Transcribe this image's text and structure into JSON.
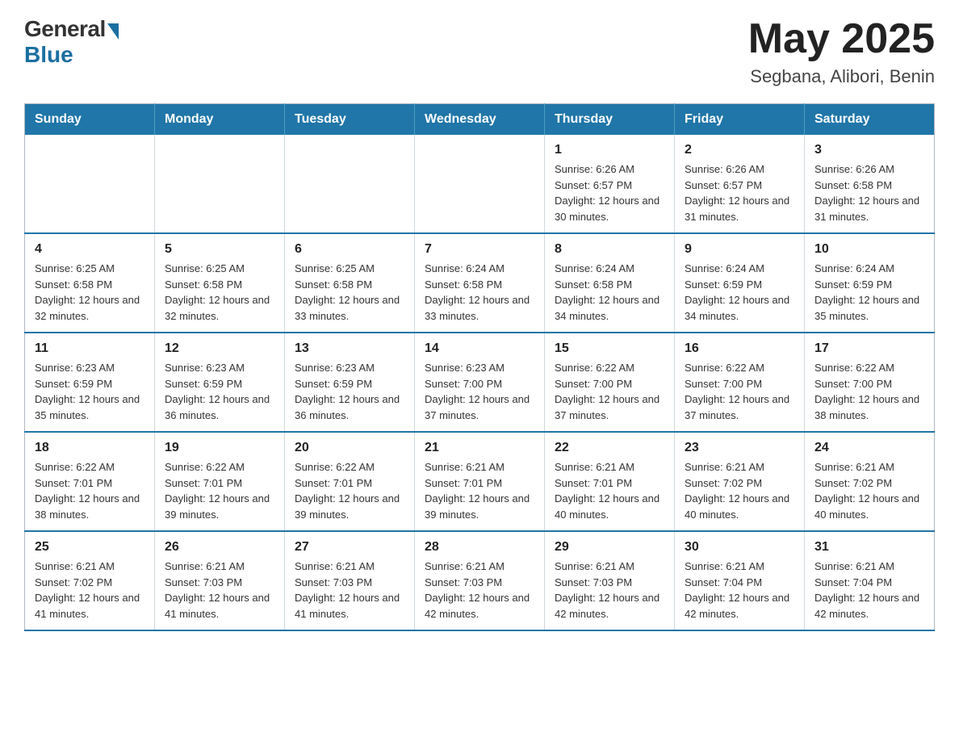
{
  "logo": {
    "general": "General",
    "blue": "Blue"
  },
  "title": {
    "month_year": "May 2025",
    "location": "Segbana, Alibori, Benin"
  },
  "weekdays": [
    "Sunday",
    "Monday",
    "Tuesday",
    "Wednesday",
    "Thursday",
    "Friday",
    "Saturday"
  ],
  "weeks": [
    [
      {
        "day": "",
        "info": ""
      },
      {
        "day": "",
        "info": ""
      },
      {
        "day": "",
        "info": ""
      },
      {
        "day": "",
        "info": ""
      },
      {
        "day": "1",
        "info": "Sunrise: 6:26 AM\nSunset: 6:57 PM\nDaylight: 12 hours and 30 minutes."
      },
      {
        "day": "2",
        "info": "Sunrise: 6:26 AM\nSunset: 6:57 PM\nDaylight: 12 hours and 31 minutes."
      },
      {
        "day": "3",
        "info": "Sunrise: 6:26 AM\nSunset: 6:58 PM\nDaylight: 12 hours and 31 minutes."
      }
    ],
    [
      {
        "day": "4",
        "info": "Sunrise: 6:25 AM\nSunset: 6:58 PM\nDaylight: 12 hours and 32 minutes."
      },
      {
        "day": "5",
        "info": "Sunrise: 6:25 AM\nSunset: 6:58 PM\nDaylight: 12 hours and 32 minutes."
      },
      {
        "day": "6",
        "info": "Sunrise: 6:25 AM\nSunset: 6:58 PM\nDaylight: 12 hours and 33 minutes."
      },
      {
        "day": "7",
        "info": "Sunrise: 6:24 AM\nSunset: 6:58 PM\nDaylight: 12 hours and 33 minutes."
      },
      {
        "day": "8",
        "info": "Sunrise: 6:24 AM\nSunset: 6:58 PM\nDaylight: 12 hours and 34 minutes."
      },
      {
        "day": "9",
        "info": "Sunrise: 6:24 AM\nSunset: 6:59 PM\nDaylight: 12 hours and 34 minutes."
      },
      {
        "day": "10",
        "info": "Sunrise: 6:24 AM\nSunset: 6:59 PM\nDaylight: 12 hours and 35 minutes."
      }
    ],
    [
      {
        "day": "11",
        "info": "Sunrise: 6:23 AM\nSunset: 6:59 PM\nDaylight: 12 hours and 35 minutes."
      },
      {
        "day": "12",
        "info": "Sunrise: 6:23 AM\nSunset: 6:59 PM\nDaylight: 12 hours and 36 minutes."
      },
      {
        "day": "13",
        "info": "Sunrise: 6:23 AM\nSunset: 6:59 PM\nDaylight: 12 hours and 36 minutes."
      },
      {
        "day": "14",
        "info": "Sunrise: 6:23 AM\nSunset: 7:00 PM\nDaylight: 12 hours and 37 minutes."
      },
      {
        "day": "15",
        "info": "Sunrise: 6:22 AM\nSunset: 7:00 PM\nDaylight: 12 hours and 37 minutes."
      },
      {
        "day": "16",
        "info": "Sunrise: 6:22 AM\nSunset: 7:00 PM\nDaylight: 12 hours and 37 minutes."
      },
      {
        "day": "17",
        "info": "Sunrise: 6:22 AM\nSunset: 7:00 PM\nDaylight: 12 hours and 38 minutes."
      }
    ],
    [
      {
        "day": "18",
        "info": "Sunrise: 6:22 AM\nSunset: 7:01 PM\nDaylight: 12 hours and 38 minutes."
      },
      {
        "day": "19",
        "info": "Sunrise: 6:22 AM\nSunset: 7:01 PM\nDaylight: 12 hours and 39 minutes."
      },
      {
        "day": "20",
        "info": "Sunrise: 6:22 AM\nSunset: 7:01 PM\nDaylight: 12 hours and 39 minutes."
      },
      {
        "day": "21",
        "info": "Sunrise: 6:21 AM\nSunset: 7:01 PM\nDaylight: 12 hours and 39 minutes."
      },
      {
        "day": "22",
        "info": "Sunrise: 6:21 AM\nSunset: 7:01 PM\nDaylight: 12 hours and 40 minutes."
      },
      {
        "day": "23",
        "info": "Sunrise: 6:21 AM\nSunset: 7:02 PM\nDaylight: 12 hours and 40 minutes."
      },
      {
        "day": "24",
        "info": "Sunrise: 6:21 AM\nSunset: 7:02 PM\nDaylight: 12 hours and 40 minutes."
      }
    ],
    [
      {
        "day": "25",
        "info": "Sunrise: 6:21 AM\nSunset: 7:02 PM\nDaylight: 12 hours and 41 minutes."
      },
      {
        "day": "26",
        "info": "Sunrise: 6:21 AM\nSunset: 7:03 PM\nDaylight: 12 hours and 41 minutes."
      },
      {
        "day": "27",
        "info": "Sunrise: 6:21 AM\nSunset: 7:03 PM\nDaylight: 12 hours and 41 minutes."
      },
      {
        "day": "28",
        "info": "Sunrise: 6:21 AM\nSunset: 7:03 PM\nDaylight: 12 hours and 42 minutes."
      },
      {
        "day": "29",
        "info": "Sunrise: 6:21 AM\nSunset: 7:03 PM\nDaylight: 12 hours and 42 minutes."
      },
      {
        "day": "30",
        "info": "Sunrise: 6:21 AM\nSunset: 7:04 PM\nDaylight: 12 hours and 42 minutes."
      },
      {
        "day": "31",
        "info": "Sunrise: 6:21 AM\nSunset: 7:04 PM\nDaylight: 12 hours and 42 minutes."
      }
    ]
  ]
}
